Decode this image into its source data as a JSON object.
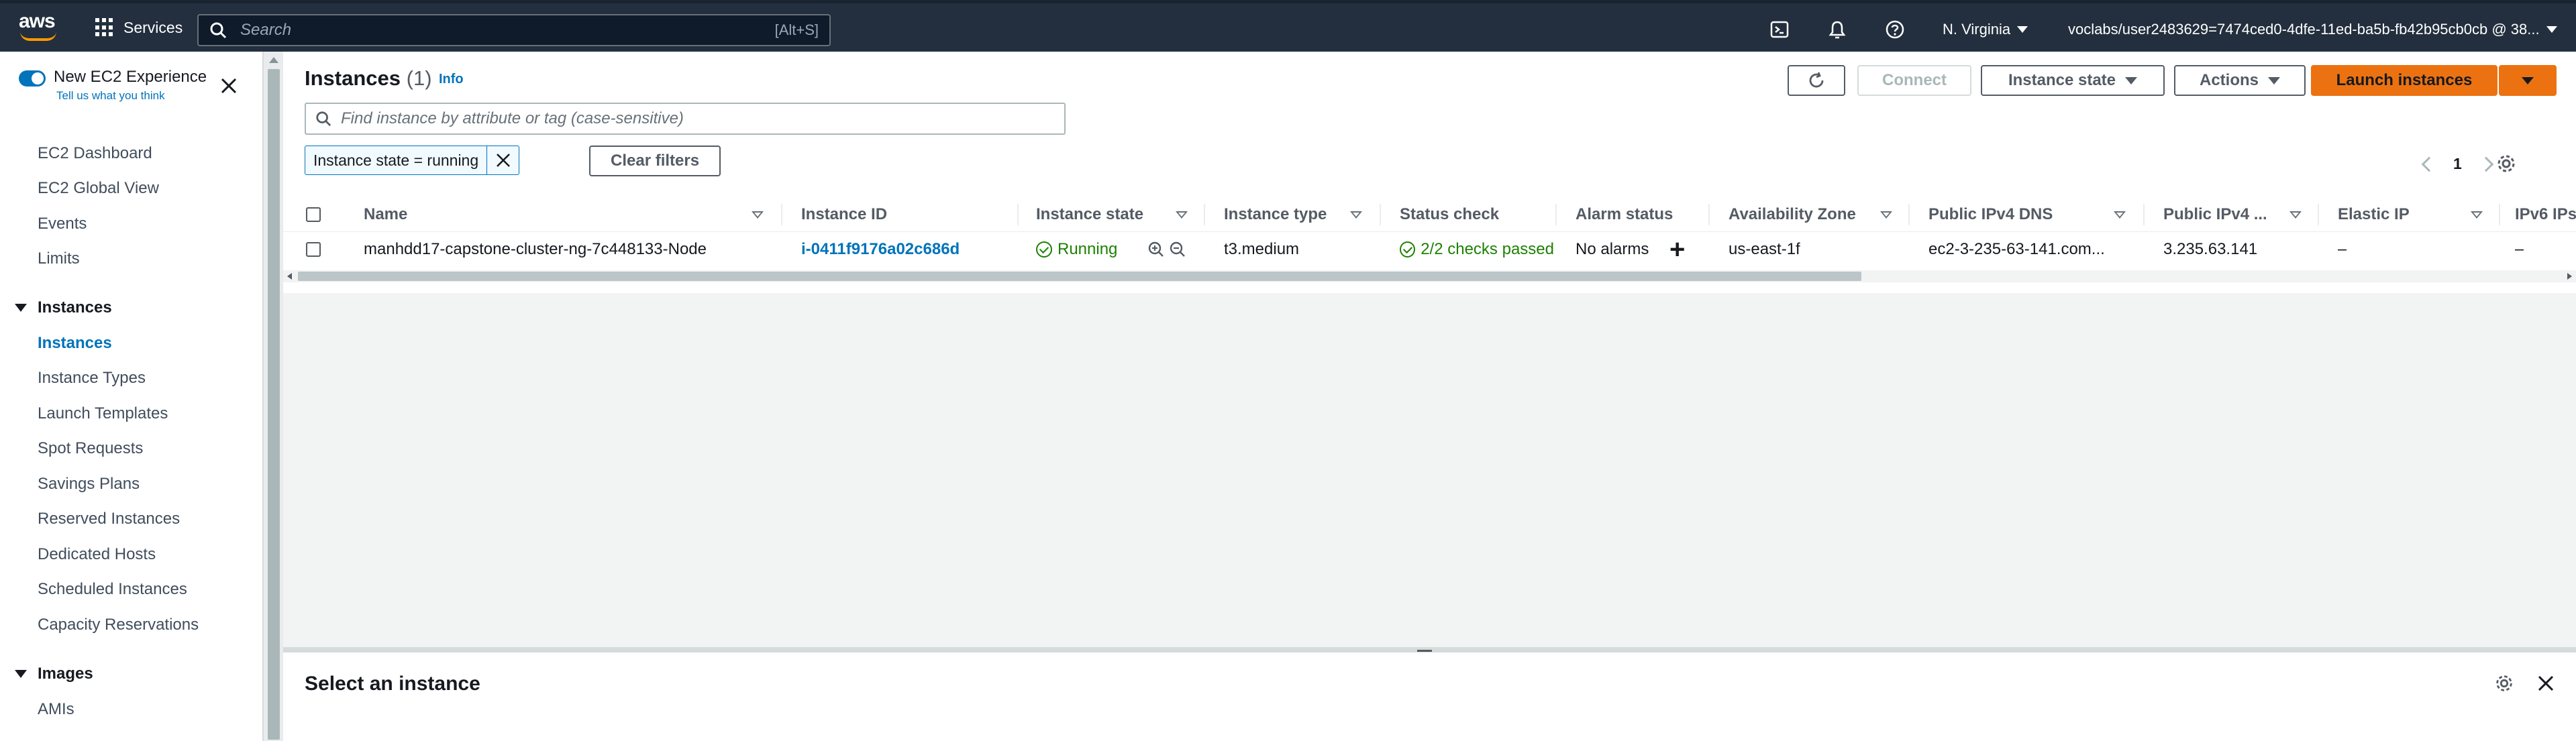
{
  "topnav": {
    "logo_text": "aws",
    "services_label": "Services",
    "search_placeholder": "Search",
    "search_shortcut": "[Alt+S]",
    "region": "N. Virginia",
    "account": "voclabs/user2483629=7474ced0-4dfe-11ed-ba5b-fb42b95cb0cb @ 38..."
  },
  "sidebar": {
    "experience_title": "New EC2 Experience",
    "experience_link": "Tell us what you think",
    "items_top": [
      "EC2 Dashboard",
      "EC2 Global View",
      "Events",
      "Limits"
    ],
    "sections": [
      {
        "title": "Instances",
        "items": [
          "Instances",
          "Instance Types",
          "Launch Templates",
          "Spot Requests",
          "Savings Plans",
          "Reserved Instances",
          "Dedicated Hosts",
          "Scheduled Instances",
          "Capacity Reservations"
        ],
        "active": "Instances"
      },
      {
        "title": "Images",
        "items": [
          "AMIs"
        ]
      }
    ]
  },
  "main": {
    "title": "Instances",
    "count": "(1)",
    "info": "Info",
    "buttons": {
      "connect": "Connect",
      "instance_state": "Instance state",
      "actions": "Actions",
      "launch": "Launch instances"
    },
    "filter_placeholder": "Find instance by attribute or tag (case-sensitive)",
    "token": "Instance state = running",
    "clear_filters": "Clear filters",
    "page": "1",
    "columns": [
      "Name",
      "Instance ID",
      "Instance state",
      "Instance type",
      "Status check",
      "Alarm status",
      "Availability Zone",
      "Public IPv4 DNS",
      "Public IPv4 ...",
      "Elastic IP",
      "IPv6 IPs"
    ],
    "row": {
      "name": "manhdd17-capstone-cluster-ng-7c448133-Node",
      "instance_id": "i-0411f9176a02c686d",
      "state": "Running",
      "type": "t3.medium",
      "status_check": "2/2 checks passed",
      "alarm": "No alarms",
      "az": "us-east-1f",
      "dns": "ec2-3-235-63-141.com...",
      "ipv4": "3.235.63.141",
      "elastic_ip": "–",
      "ipv6": "–"
    },
    "bottom_title": "Select an instance"
  },
  "colors": {
    "nav_bg": "#232f3e",
    "link": "#0073bb",
    "primary": "#ec7211",
    "success": "#1d8102"
  }
}
